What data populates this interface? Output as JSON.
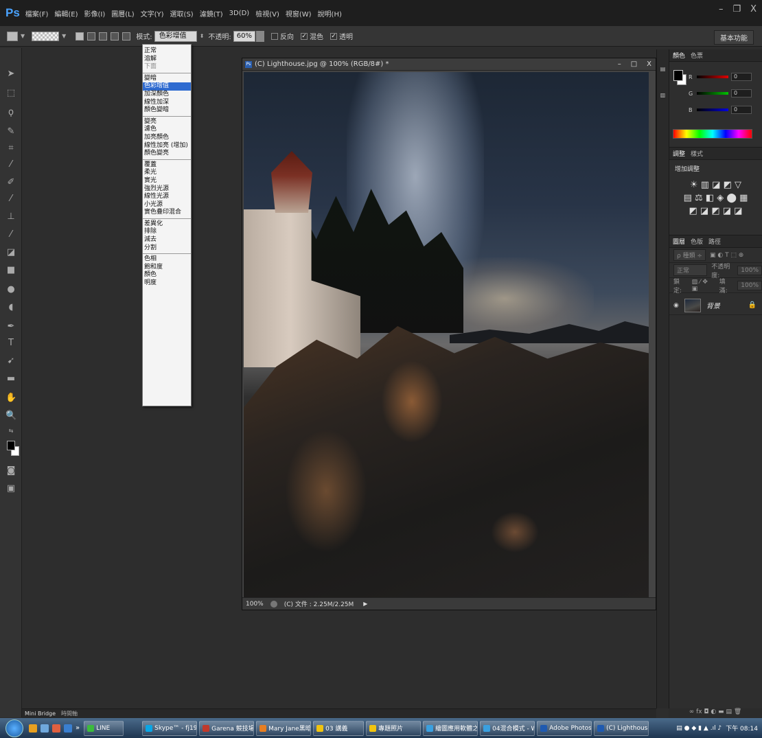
{
  "menubar": {
    "logo": "Ps",
    "items": [
      "檔案(F)",
      "編輯(E)",
      "影像(I)",
      "圖層(L)",
      "文字(Y)",
      "選取(S)",
      "濾鏡(T)",
      "3D(D)",
      "檢視(V)",
      "視窗(W)",
      "說明(H)"
    ],
    "window_controls": [
      "–",
      "❐",
      "X"
    ]
  },
  "options": {
    "mode_label": "模式:",
    "mode_value": "色彩增值",
    "opacity_label": "不透明:",
    "opacity_value": "60%",
    "reverse_label": "反向",
    "dither_label": "混色",
    "transparency_label": "透明",
    "dither_checked": "✓",
    "transparency_checked": "✓",
    "workspace": "基本功能"
  },
  "dropdown": {
    "groups": [
      [
        "正常",
        "溶解",
        "下面"
      ],
      [
        "變暗",
        "色彩增值",
        "加深顏色",
        "線性加深",
        "顏色變暗"
      ],
      [
        "變亮",
        "濾色",
        "加亮顏色",
        "線性加亮 (增加)",
        "顏色變亮"
      ],
      [
        "覆蓋",
        "柔光",
        "實光",
        "強烈光源",
        "線性光源",
        "小光源",
        "實色疊印混合"
      ],
      [
        "差異化",
        "排除",
        "減去",
        "分割"
      ],
      [
        "色相",
        "飽和度",
        "顏色",
        "明度"
      ]
    ],
    "selected": "色彩增值",
    "disabled": [
      "下面"
    ]
  },
  "document": {
    "title": "(C) Lighthouse.jpg @ 100% (RGB/8#) *",
    "controls": [
      "–",
      "□",
      "X"
    ],
    "zoom": "100%",
    "file_info": "(C) 文件 : 2.25M/2.25M"
  },
  "color_panel": {
    "tabs": [
      "顏色",
      "色票"
    ],
    "r_label": "R",
    "g_label": "G",
    "b_label": "B",
    "r_value": "0",
    "g_value": "0",
    "b_value": "0",
    "colors": {
      "r": "#e00000",
      "g": "#00c000",
      "b": "#0000e0"
    }
  },
  "adjust_panel": {
    "tabs": [
      "調整",
      "樣式"
    ],
    "add_label": "增加調整",
    "row1": "☀ ▥ ◪ ◩ ▽",
    "row2": "▤ ⚖ ◧ ◈ ⬤ ▦",
    "row3": "◩ ◪ ◩ ◪ ◪"
  },
  "layers_panel": {
    "tabs": [
      "圖層",
      "色版",
      "路徑"
    ],
    "kind_label": "ρ 種類 ÷",
    "blend_value": "正常",
    "opacity_label": "不透明度:",
    "opacity_value": "100%",
    "lock_label": "鎖定:",
    "fill_label": "填滿:",
    "fill_value": "100%",
    "layer_name": "背景",
    "eye": "◉",
    "lock_icon": "🔒"
  },
  "panel_toolbar": "∞ fx ◘ ◐ ▬ ▤ 🗑",
  "bridge": {
    "tabs": [
      "Mini Bridge",
      "時間軸"
    ]
  },
  "taskbar": {
    "items": [
      {
        "label": "LINE",
        "color": "#3cbb3c"
      },
      {
        "label": "Skype™ - fj1948...",
        "color": "#0aa6e6"
      },
      {
        "label": "Garena 競技場 - ...",
        "color": "#c0392b"
      },
      {
        "label": "Mary Jane黑暗彩...",
        "color": "#e67e22"
      },
      {
        "label": "03 講義",
        "color": "#f1c40f"
      },
      {
        "label": "專題照片",
        "color": "#f1c40f"
      },
      {
        "label": "繪圖應用軟體之...",
        "color": "#3aa0e0"
      },
      {
        "label": "04混合模式 - Wi...",
        "color": "#3aa0e0"
      },
      {
        "label": "Adobe Photosh...",
        "color": "#1f5ab0"
      },
      {
        "label": "(C) Lighthouse.j...",
        "color": "#1f5ab0"
      }
    ],
    "clock": "下午 08:14"
  }
}
